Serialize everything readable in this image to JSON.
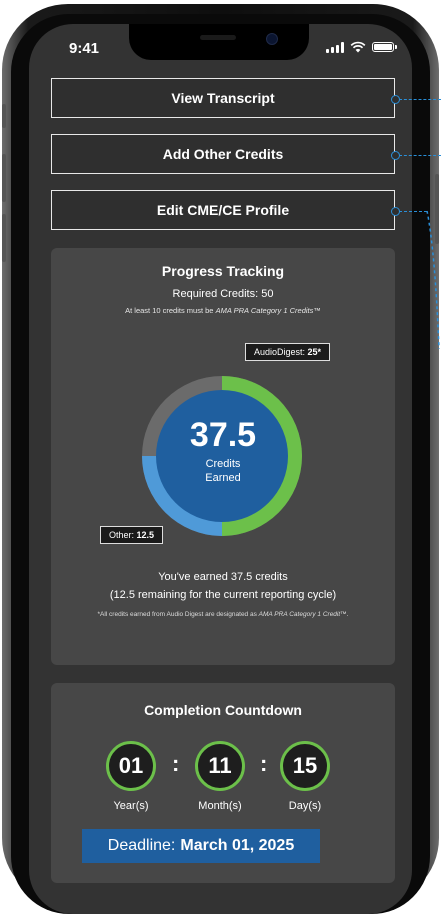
{
  "status": {
    "time": "9:41"
  },
  "actions": {
    "view_transcript": "View Transcript",
    "add_credits": "Add Other Credits",
    "edit_profile": "Edit CME/CE Profile"
  },
  "progress": {
    "title": "Progress Tracking",
    "required": "Required Credits: 50",
    "note_prefix": "At least 10 credits must be ",
    "note_em": "AMA PRA Category 1 Credits™",
    "total": "37.5",
    "credits_label_1": "Credits",
    "credits_label_2": "Earned",
    "audio_label": "AudioDigest: ",
    "audio_value": "25*",
    "other_label": "Other: ",
    "other_value": "12.5",
    "summary_1": "You've earned 37.5 credits",
    "summary_2": "(12.5 remaining for the current reporting cycle)",
    "footnote_prefix": "*All credits earned from Audio Digest are designated as ",
    "footnote_em": "AMA PRA Category 1 Credit™",
    "footnote_suffix": ".",
    "chart": {
      "required": 50,
      "audio_digest": 25,
      "other": 12.5,
      "colors": {
        "audio": "#6cc04a",
        "other": "#4f9ad8",
        "remaining": "#6b6b6b",
        "center": "#1f5f9f"
      }
    }
  },
  "countdown": {
    "title": "Completion Countdown",
    "years": "01",
    "months": "11",
    "days": "15",
    "sep": ":",
    "years_label": "Year(s)",
    "months_label": "Month(s)",
    "days_label": "Day(s)",
    "deadline_label": "Deadline:",
    "deadline_date": "March 01, 2025"
  }
}
